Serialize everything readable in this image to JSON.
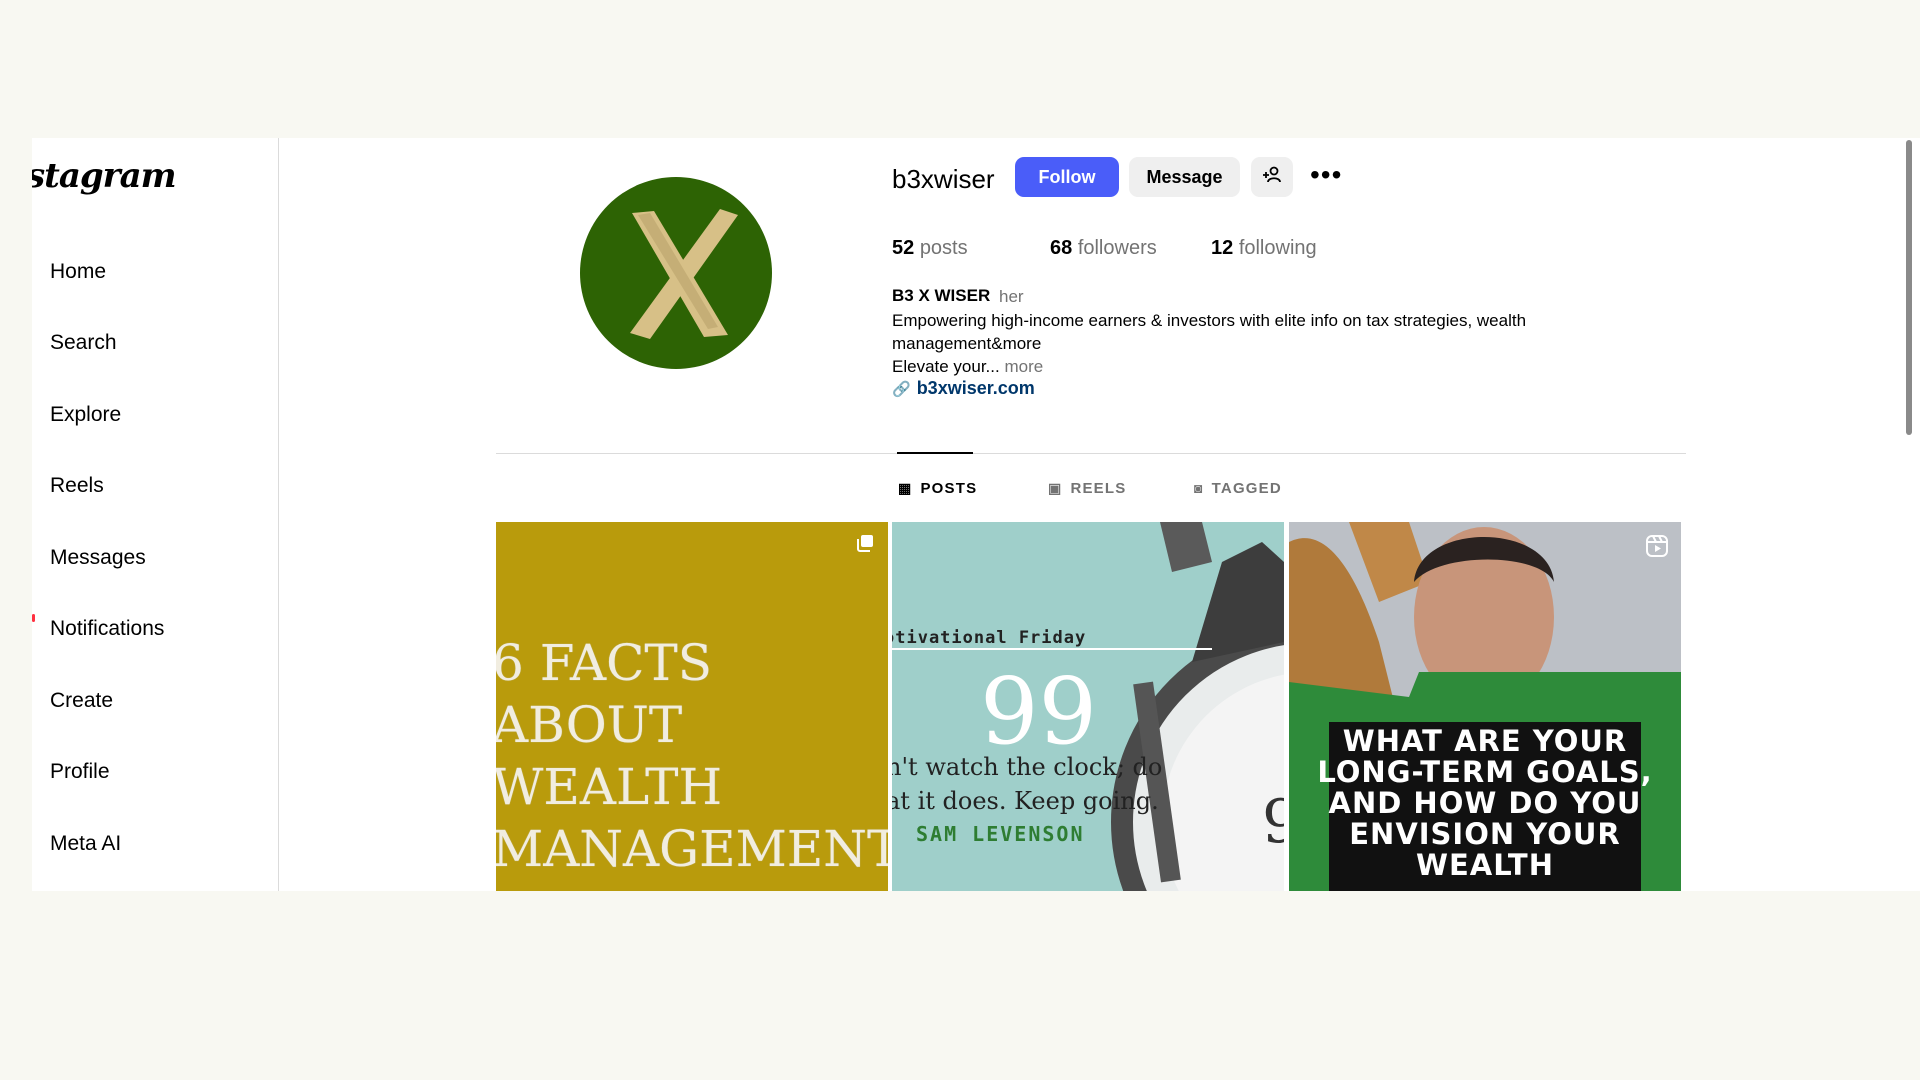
{
  "app": {
    "logo_text": "stagram"
  },
  "sidebar": {
    "items": [
      {
        "label": "Home"
      },
      {
        "label": "Search"
      },
      {
        "label": "Explore"
      },
      {
        "label": "Reels"
      },
      {
        "label": "Messages"
      },
      {
        "label": "Notifications"
      },
      {
        "label": "Create"
      },
      {
        "label": "Profile"
      },
      {
        "label": "Meta AI"
      }
    ]
  },
  "profile": {
    "username": "b3xwiser",
    "follow_label": "Follow",
    "message_label": "Message",
    "posts_count": "52",
    "posts_label": "posts",
    "followers_count": "68",
    "followers_label": "followers",
    "following_count": "12",
    "following_label": "following",
    "full_name": "B3 X WISER",
    "pronouns": "her",
    "bio_line1": "Empowering high-income earners & investors with elite info on tax strategies, wealth management&more",
    "bio_line2": "Elevate your...",
    "bio_more": "more",
    "link": "b3xwiser.com",
    "avatar_letter": "X",
    "avatar_bg": "#2d6304",
    "avatar_letter_color": "#d7c087"
  },
  "tabs": [
    {
      "label": "POSTS",
      "icon": "grid-icon",
      "active": true
    },
    {
      "label": "REELS",
      "icon": "reels-icon",
      "active": false
    },
    {
      "label": "TAGGED",
      "icon": "tagged-icon",
      "active": false
    }
  ],
  "posts": [
    {
      "text": "6 FACTS\nABOUT\nWEALTH\nMANAGEMENT",
      "badge": "carousel-icon"
    },
    {
      "heading": "otivational Friday",
      "quote_mark": "99",
      "text": "n't watch the clock; do\nat it does. Keep going.",
      "author": "SAM LEVENSON"
    },
    {
      "text": "WHAT ARE YOUR\nLONG-TERM GOALS,\nAND HOW DO YOU\nENVISION YOUR\nWEALTH",
      "badge": "reel-icon"
    }
  ],
  "colors": {
    "follow_button": "#4a5df9",
    "link": "#00376b",
    "post1_bg": "#b99b0c",
    "post2_bg": "#9fcfca",
    "post3_green": "#2e8b3a"
  }
}
